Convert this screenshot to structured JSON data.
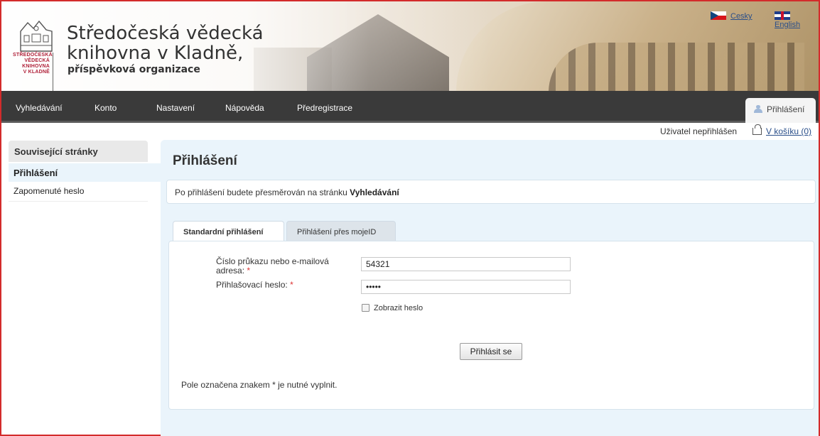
{
  "header": {
    "logo_lines": [
      "STŘEDOČESKÁ",
      "VĚDECKÁ",
      "KNIHOVNA",
      "V KLADNĚ"
    ],
    "title_line1": "Středočeská vědecká",
    "title_line2": "knihovna v Kladně,",
    "title_line3": "příspěvková organizace",
    "languages": [
      "Cesky",
      "English"
    ]
  },
  "nav": {
    "items": [
      "Vyhledávání",
      "Konto",
      "Nastavení",
      "Nápověda",
      "Předregistrace"
    ],
    "login": "Přihlášení"
  },
  "user": {
    "status": "Uživatel nepřihlášen",
    "basket": "V košíku (0)"
  },
  "sidebar": {
    "heading": "Související stránky",
    "items": [
      "Přihlášení",
      "Zapomenuté heslo"
    ]
  },
  "main": {
    "title": "Přihlášení",
    "notice_prefix": "Po přihlášení budete přesměrován na stránku",
    "notice_target": "Vyhledávání",
    "tabs": [
      "Standardní přihlášení",
      "Přihlášení přes mojeID"
    ],
    "form": {
      "id_label_1": "Číslo průkazu nebo e-mailová",
      "id_label_2": "adresa:",
      "id_value": "54321",
      "password_label": "Přihlašovací heslo:",
      "password_value": "•••••",
      "required_mark": "*",
      "show_password": "Zobrazit heslo",
      "submit": "Přihlásit se"
    },
    "footnote": "Pole označena znakem * je nutné vyplnit."
  },
  "colors": {
    "nav_bg": "#3a3a3a",
    "content_bg": "#eaf4fb",
    "link": "#2a4f8a",
    "frame_border": "#d32b2b",
    "required": "#dd3333"
  },
  "icons": [
    "library-logo-icon",
    "czech-flag-icon",
    "uk-flag-icon",
    "user-icon",
    "basket-icon",
    "checkbox-icon"
  ]
}
